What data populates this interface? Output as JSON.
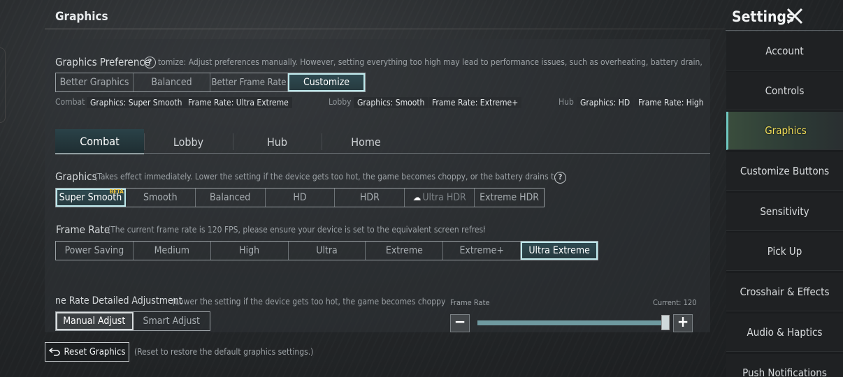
{
  "header": {
    "title": "Graphics"
  },
  "preference": {
    "label": "Graphics Preference",
    "hint": "tomize: Adjust preferences manually. However, setting everything too high may lead to performance issues, such as overheating, battery drain, or choppy",
    "options": [
      "Better Graphics",
      "Balanced",
      "Better Frame Rate",
      "Customize"
    ],
    "selected": "Customize",
    "summary": {
      "combat_key": "Combat",
      "combat_graphics": "Graphics: Super Smooth",
      "combat_frame": "Frame Rate: Ultra Extreme",
      "lobby_key": "Lobby",
      "lobby_graphics": "Graphics: Smooth",
      "lobby_frame": "Frame Rate: Extreme+",
      "hub_key": "Hub",
      "hub_graphics": "Graphics: HD",
      "hub_frame": "Frame Rate: High"
    }
  },
  "tabs": [
    "Combat",
    "Lobby",
    "Hub",
    "Home"
  ],
  "active_tab": "Combat",
  "graphics": {
    "label": "Graphics",
    "hint": "(Takes effect immediately. Lower the setting if the device gets too hot, the game becomes choppy, or the battery drains too quickly.)",
    "options": [
      "Super Smooth",
      "Smooth",
      "Balanced",
      "HD",
      "HDR",
      "Ultra HDR",
      "Extreme HDR"
    ],
    "beta_badge": "BETA",
    "selected": "Super Smooth"
  },
  "frame_rate": {
    "label": "Frame Rate",
    "hint": "(The current frame rate is 120 FPS, please ensure your device is set to the equivalent screen refresh rate)",
    "options": [
      "Power Saving",
      "Medium",
      "High",
      "Ultra",
      "Extreme",
      "Extreme+",
      "Ultra Extreme"
    ],
    "selected": "Ultra Extreme"
  },
  "detailed": {
    "label": "ne Rate Detailed Adjustment",
    "hint": "(Lower the setting if the device gets too hot, the game becomes choppy, or the",
    "options": [
      "Manual Adjust",
      "Smart Adjust"
    ],
    "selected": "Manual Adjust",
    "slider_label": "Frame Rate",
    "current_label": "Current: 120",
    "slider_value_fraction": 1.0
  },
  "reset": {
    "label": "Reset Graphics",
    "hint": "(Reset to restore the default graphics settings.)"
  },
  "sidebar": {
    "title": "Settings",
    "items": [
      "Account",
      "Controls",
      "Graphics",
      "Customize Buttons",
      "Sensitivity",
      "Pick Up",
      "Crosshair & Effects",
      "Audio & Haptics",
      "Push Notifications"
    ],
    "active": "Graphics"
  },
  "colors": {
    "accent": "#bde7ea",
    "active_menu_text": "#f3e05a",
    "beta": "#f2c53d"
  }
}
